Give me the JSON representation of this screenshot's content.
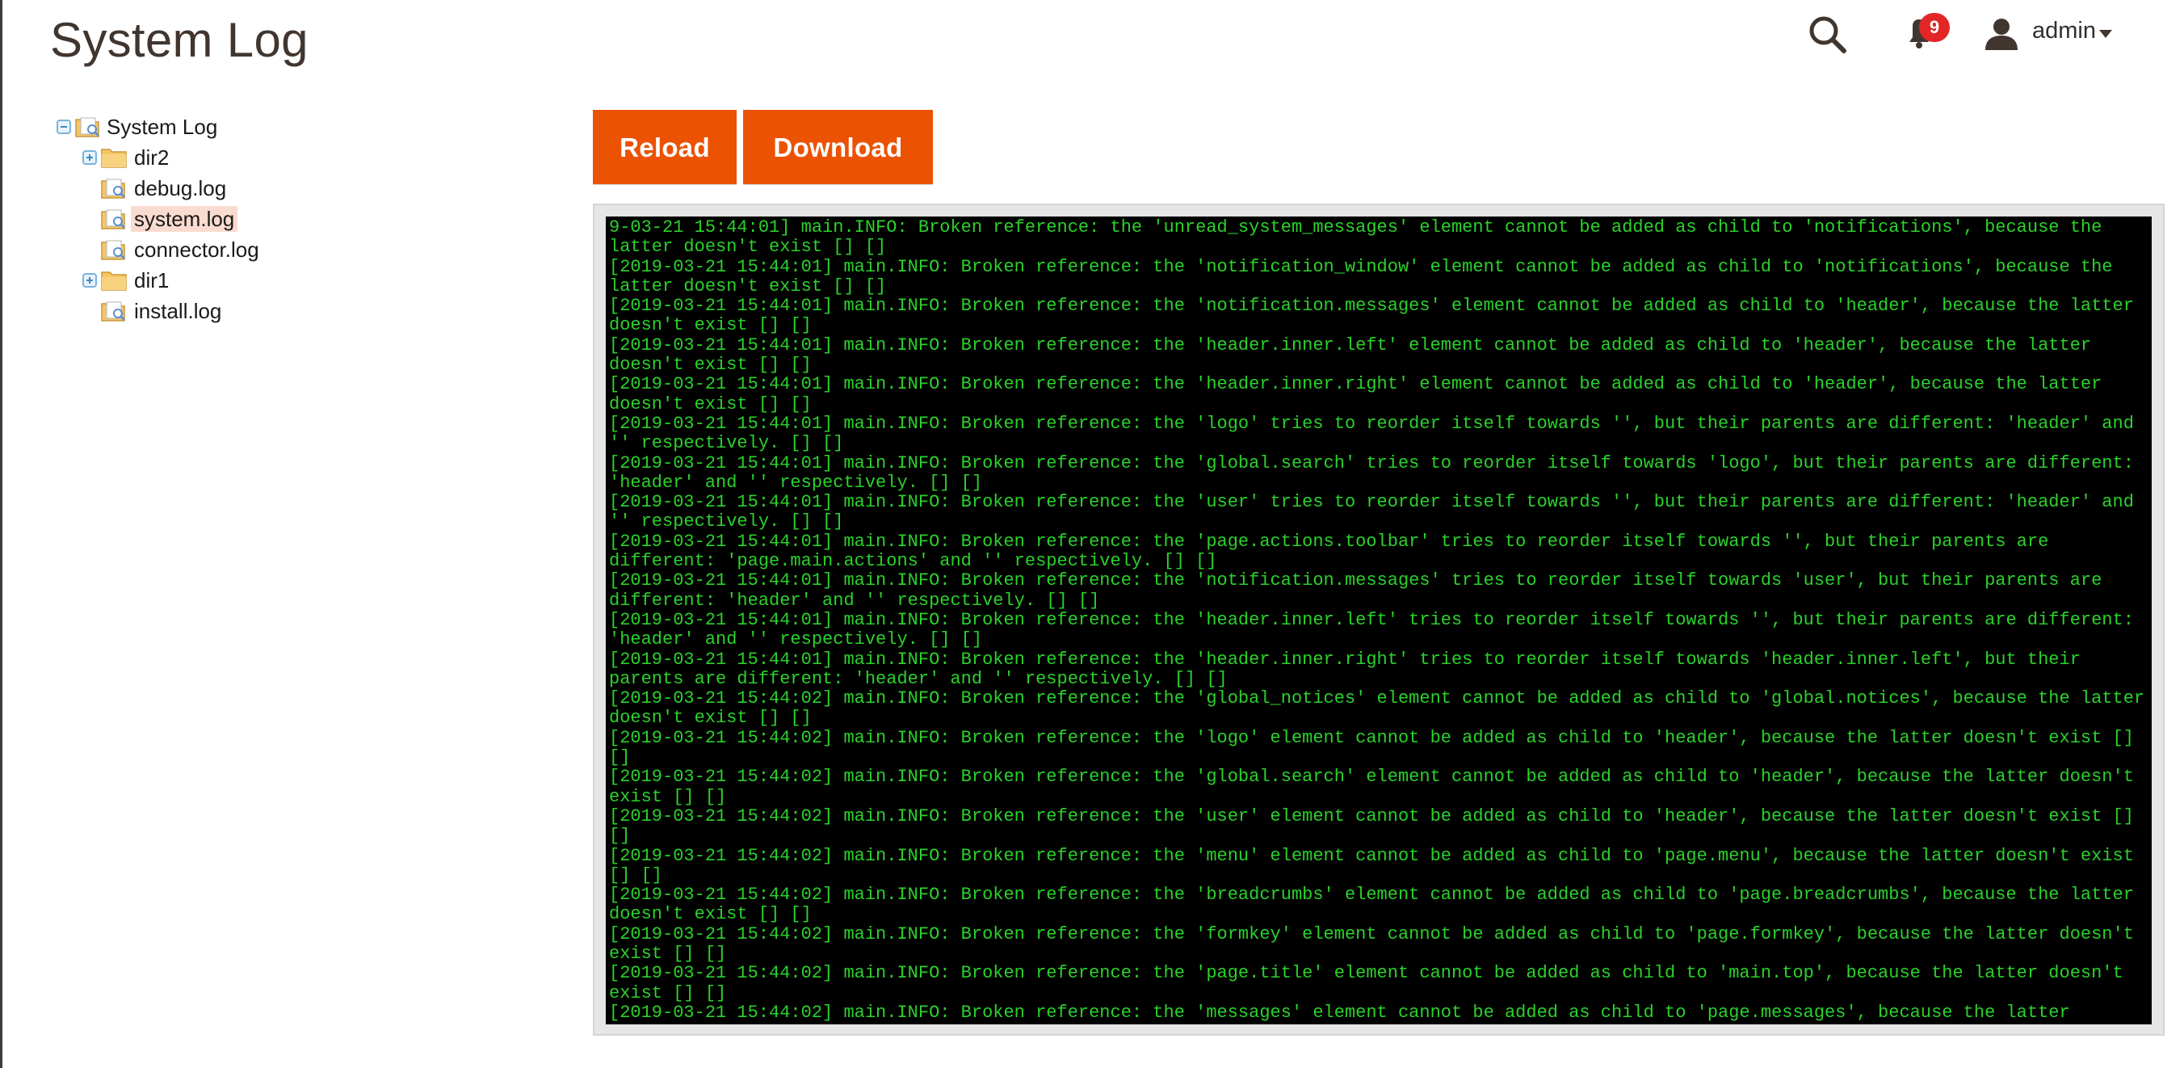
{
  "page": {
    "title": "System Log"
  },
  "header": {
    "search_icon": "search-icon",
    "notifications": {
      "icon": "bell-icon",
      "count": "9"
    },
    "user": {
      "icon": "user-icon",
      "name": "admin"
    }
  },
  "tree": {
    "root": {
      "label": "System Log",
      "expanded": true
    },
    "items": [
      {
        "label": "dir2",
        "type": "folder",
        "expanded": false
      },
      {
        "label": "debug.log",
        "type": "file"
      },
      {
        "label": "system.log",
        "type": "file",
        "selected": true
      },
      {
        "label": "connector.log",
        "type": "file"
      },
      {
        "label": "dir1",
        "type": "folder",
        "expanded": false
      },
      {
        "label": "install.log",
        "type": "file"
      }
    ]
  },
  "actions": {
    "reload": "Reload",
    "download": "Download",
    "accent": "#eb5202"
  },
  "log": {
    "text_color": "#2bd12b",
    "background": "#000000",
    "lines": [
      "9-03-21 15:44:01] main.INFO: Broken reference: the 'unread_system_messages' element cannot be added as child to 'notifications', because the latter doesn't exist [] []",
      "[2019-03-21 15:44:01] main.INFO: Broken reference: the 'notification_window' element cannot be added as child to 'notifications', because the latter doesn't exist [] []",
      "[2019-03-21 15:44:01] main.INFO: Broken reference: the 'notification.messages' element cannot be added as child to 'header', because the latter doesn't exist [] []",
      "[2019-03-21 15:44:01] main.INFO: Broken reference: the 'header.inner.left' element cannot be added as child to 'header', because the latter doesn't exist [] []",
      "[2019-03-21 15:44:01] main.INFO: Broken reference: the 'header.inner.right' element cannot be added as child to 'header', because the latter doesn't exist [] []",
      "[2019-03-21 15:44:01] main.INFO: Broken reference: the 'logo' tries to reorder itself towards '', but their parents are different: 'header' and '' respectively. [] []",
      "[2019-03-21 15:44:01] main.INFO: Broken reference: the 'global.search' tries to reorder itself towards 'logo', but their parents are different: 'header' and '' respectively. [] []",
      "[2019-03-21 15:44:01] main.INFO: Broken reference: the 'user' tries to reorder itself towards '', but their parents are different: 'header' and '' respectively. [] []",
      "[2019-03-21 15:44:01] main.INFO: Broken reference: the 'page.actions.toolbar' tries to reorder itself towards '', but their parents are different: 'page.main.actions' and '' respectively. [] []",
      "[2019-03-21 15:44:01] main.INFO: Broken reference: the 'notification.messages' tries to reorder itself towards 'user', but their parents are different: 'header' and '' respectively. [] []",
      "[2019-03-21 15:44:01] main.INFO: Broken reference: the 'header.inner.left' tries to reorder itself towards '', but their parents are different: 'header' and '' respectively. [] []",
      "[2019-03-21 15:44:01] main.INFO: Broken reference: the 'header.inner.right' tries to reorder itself towards 'header.inner.left', but their parents are different: 'header' and '' respectively. [] []",
      "[2019-03-21 15:44:02] main.INFO: Broken reference: the 'global_notices' element cannot be added as child to 'global.notices', because the latter doesn't exist [] []",
      "[2019-03-21 15:44:02] main.INFO: Broken reference: the 'logo' element cannot be added as child to 'header', because the latter doesn't exist [] []",
      "[2019-03-21 15:44:02] main.INFO: Broken reference: the 'global.search' element cannot be added as child to 'header', because the latter doesn't exist [] []",
      "[2019-03-21 15:44:02] main.INFO: Broken reference: the 'user' element cannot be added as child to 'header', because the latter doesn't exist [] []",
      "[2019-03-21 15:44:02] main.INFO: Broken reference: the 'menu' element cannot be added as child to 'page.menu', because the latter doesn't exist [] []",
      "[2019-03-21 15:44:02] main.INFO: Broken reference: the 'breadcrumbs' element cannot be added as child to 'page.breadcrumbs', because the latter doesn't exist [] []",
      "[2019-03-21 15:44:02] main.INFO: Broken reference: the 'formkey' element cannot be added as child to 'page.formkey', because the latter doesn't exist [] []",
      "[2019-03-21 15:44:02] main.INFO: Broken reference: the 'page.title' element cannot be added as child to 'main.top', because the latter doesn't exist [] []",
      "[2019-03-21 15:44:02] main.INFO: Broken reference: the 'messages' element cannot be added as child to 'page.messages', because the latter"
    ]
  }
}
